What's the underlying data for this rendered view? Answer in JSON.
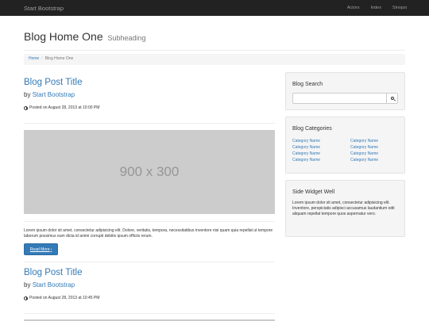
{
  "navbar": {
    "brand": "Start Bootstrap",
    "links": [
      "Actors",
      "Index",
      "Sinopsi"
    ]
  },
  "header": {
    "title": "Blog Home One",
    "subtitle": "Subheading"
  },
  "breadcrumb": {
    "home": "Home",
    "separator": "/",
    "current": "Blog Home One"
  },
  "posts": [
    {
      "title": "Blog Post Title",
      "by": "by",
      "author": "Start Bootstrap",
      "date": "Posted on August 28, 2013 at 10:00 PM",
      "image_placeholder": "900 x 300",
      "excerpt": "Lorem ipsum dolor sit amet, consectetur adipisicing elit. Dolore, veritatis, tempora, necessitatibus inventore nisi quam quia repellat ut tempore laborum possimus eum dicta id animi corrupti debitis ipsum officiis rerum.",
      "button": "Read More",
      "button_icon": "chevron-right-icon"
    },
    {
      "title": "Blog Post Title",
      "by": "by",
      "author": "Start Bootstrap",
      "date": "Posted on August 28, 2013 at 10:45 PM"
    }
  ],
  "sidebar": {
    "search": {
      "title": "Blog Search",
      "placeholder": "",
      "button_icon": "search-icon"
    },
    "categories": {
      "title": "Blog Categories",
      "left": [
        "Category Name",
        "Category Name",
        "Category Name",
        "Category Name"
      ],
      "right": [
        "Category Name",
        "Category Name",
        "Category Name",
        "Category Name"
      ]
    },
    "widget": {
      "title": "Side Widget Well",
      "text": "Lorem ipsum dolor sit amet, consectetur adipisicing elit. Inventore, perspiciatis adipisci accusamus laudantium odit aliquam repellat tempore quos aspernatur vero."
    }
  },
  "colors": {
    "navbar_bg": "#222222",
    "link": "#337ab7",
    "button": "#337ab7",
    "placeholder_bg": "#cccccc",
    "well_bg": "#f5f5f5"
  }
}
